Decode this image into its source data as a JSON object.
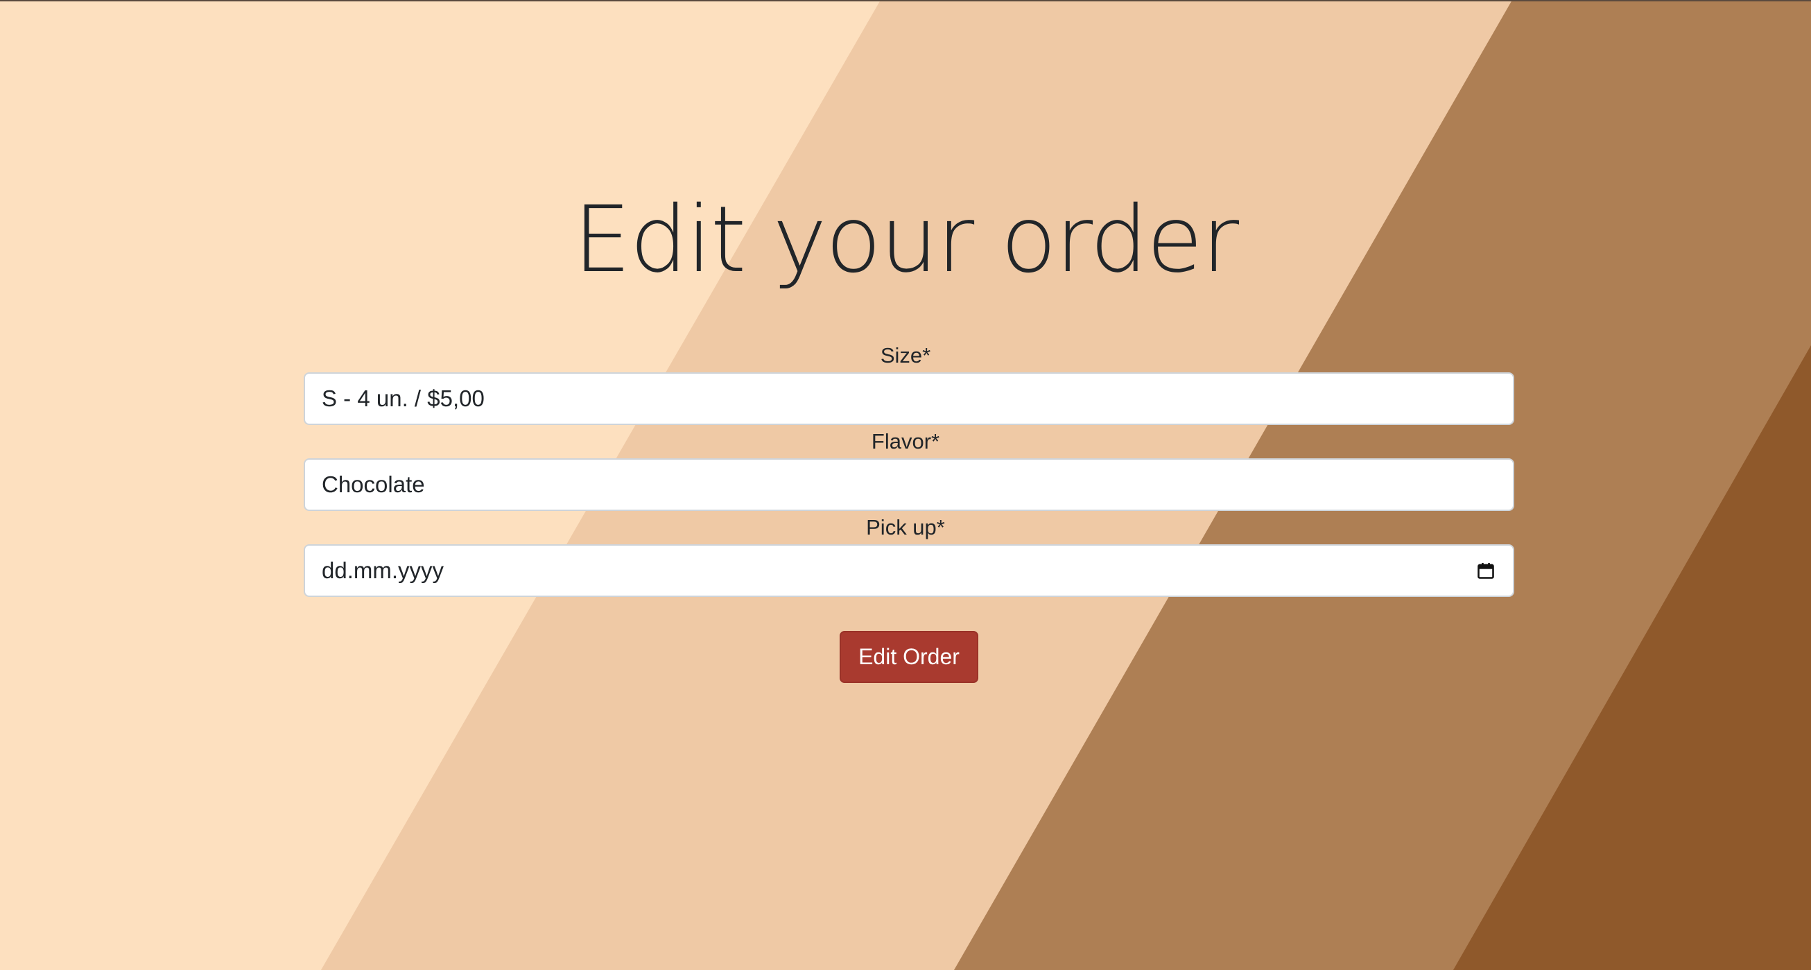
{
  "page": {
    "title": "Edit your order"
  },
  "theme": {
    "band_colors": [
      "#fde0bf",
      "#efc9a5",
      "#ae7f54",
      "#8f592b"
    ],
    "button_color": "#a93a2f"
  },
  "form": {
    "size": {
      "label": "Size*",
      "value": "S - 4 un. / $5,00"
    },
    "flavor": {
      "label": "Flavor*",
      "value": "Chocolate"
    },
    "pickup": {
      "label": "Pick up*",
      "placeholder": "dd.mm.yyyy",
      "icon": "calendar-icon"
    },
    "submit_label": "Edit Order"
  }
}
